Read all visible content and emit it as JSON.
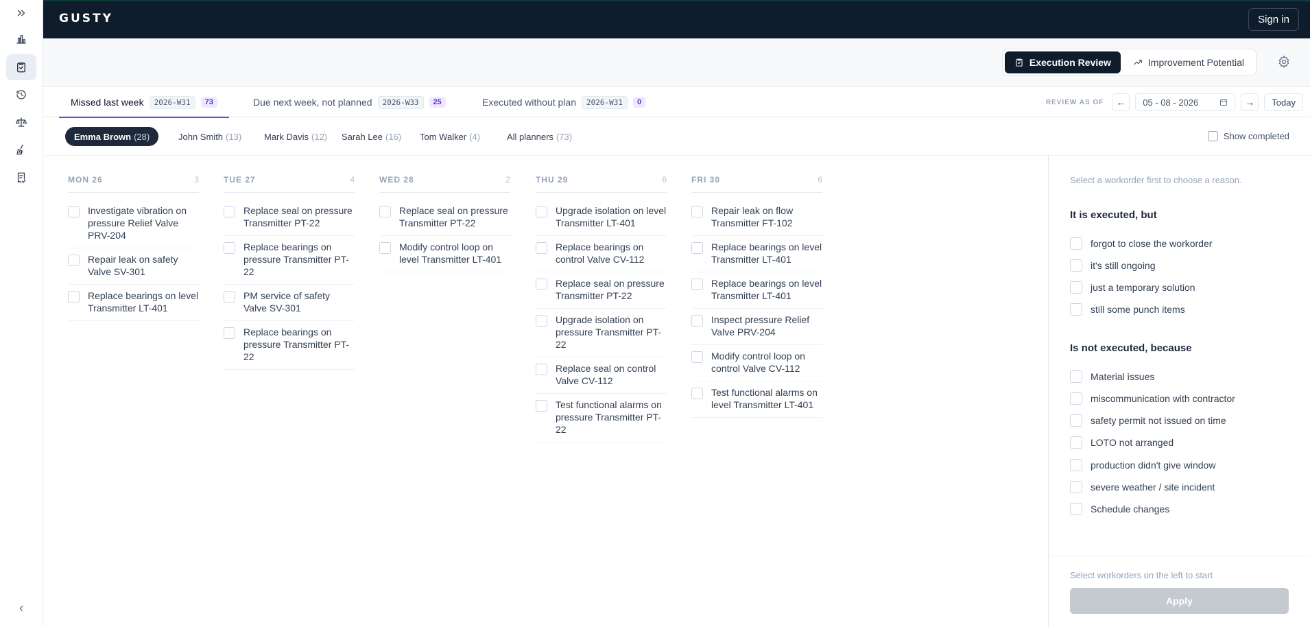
{
  "app": {
    "logo": "GUSTY",
    "sign_in": "Sign in"
  },
  "rail": {
    "items": [
      {
        "icon": "chevrons-right-icon"
      },
      {
        "icon": "bar-chart-icon"
      },
      {
        "icon": "clipboard-check-icon"
      },
      {
        "icon": "history-icon"
      },
      {
        "icon": "scale-icon"
      },
      {
        "icon": "broom-icon"
      },
      {
        "icon": "receipt-check-icon"
      },
      {
        "icon": "chevron-left-icon"
      }
    ]
  },
  "toolbar": {
    "views": [
      {
        "label": "Execution Review",
        "active": true,
        "icon": "clipboard-check-icon"
      },
      {
        "label": "Improvement Potential",
        "active": false,
        "icon": "trending-up-icon"
      }
    ],
    "settings_icon": "gear-icon"
  },
  "tabs": [
    {
      "label": "Missed last week",
      "week": "2026-W31",
      "count": "73",
      "active": true
    },
    {
      "label": "Due next week, not planned",
      "week": "2026-W33",
      "count": "25",
      "active": false
    },
    {
      "label": "Executed without plan",
      "week": "2026-W31",
      "count": "0",
      "active": false
    }
  ],
  "review": {
    "label": "REVIEW AS OF",
    "prev": "←",
    "date": "05 - 08 - 2026",
    "next": "→",
    "today": "Today"
  },
  "planners": [
    {
      "name": "Emma Brown",
      "count": "(28)",
      "active": true
    },
    {
      "name": "John Smith",
      "count": "(13)",
      "active": false
    },
    {
      "name": "Mark Davis",
      "count": "(12)",
      "active": false
    },
    {
      "name": "Sarah Lee",
      "count": "(16)",
      "active": false
    },
    {
      "name": "Tom Walker",
      "count": "(4)",
      "active": false
    },
    {
      "name": "All planners",
      "count": "(73)",
      "active": false
    }
  ],
  "show_completed": "Show completed",
  "days": [
    {
      "label": "MON 26",
      "count": "3",
      "items": [
        "Investigate vibration on pressure Relief Valve PRV-204",
        "Repair leak on safety Valve SV-301",
        "Replace bearings on level Transmitter LT-401"
      ]
    },
    {
      "label": "TUE 27",
      "count": "4",
      "items": [
        "Replace seal on pressure Transmitter PT-22",
        "Replace bearings on pressure Transmitter PT-22",
        "PM service of safety Valve SV-301",
        "Replace bearings on pressure Transmitter PT-22"
      ]
    },
    {
      "label": "WED 28",
      "count": "2",
      "items": [
        "Replace seal on pressure Transmitter PT-22",
        "Modify control loop on level Transmitter LT-401"
      ]
    },
    {
      "label": "THU 29",
      "count": "6",
      "items": [
        "Upgrade isolation on level Transmitter LT-401",
        "Replace bearings on control Valve CV-112",
        "Replace seal on pressure Transmitter PT-22",
        "Upgrade isolation on pressure Transmitter PT-22",
        "Replace seal on control Valve CV-112",
        "Test functional alarms on pressure Transmitter PT-22"
      ]
    },
    {
      "label": "FRI 30",
      "count": "6",
      "items": [
        "Repair leak on flow Transmitter FT-102",
        "Replace bearings on level Transmitter LT-401",
        "Replace bearings on level Transmitter LT-401",
        "Inspect pressure Relief Valve PRV-204",
        "Modify control loop on control Valve CV-112",
        "Test functional alarms on level Transmitter LT-401"
      ]
    }
  ],
  "panel": {
    "hint": "Select a workorder first to choose a reason.",
    "executed_title": "It is executed, but",
    "executed_reasons": [
      "forgot to close the workorder",
      "it's still ongoing",
      "just a temporary solution",
      "still some punch items"
    ],
    "not_executed_title": "Is not executed, because",
    "not_executed_reasons": [
      "Material issues",
      "miscommunication with contractor",
      "safety permit not issued on time",
      "LOTO not arranged",
      "production didn't give window",
      "severe weather / site incident",
      "Schedule changes"
    ],
    "footer_hint": "Select workorders on the left to start",
    "apply": "Apply"
  }
}
